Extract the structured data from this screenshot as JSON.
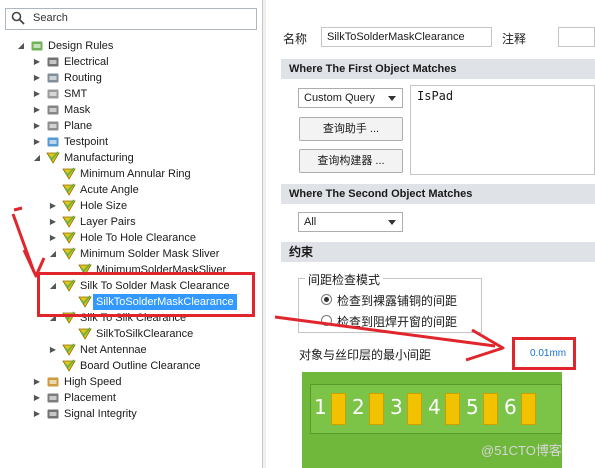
{
  "search": {
    "placeholder": "Search"
  },
  "tree": [
    {
      "label": "Design Rules",
      "arrow": "◢",
      "icon": "design-rules-icon"
    },
    {
      "label": "Electrical",
      "arrow": "▶",
      "icon": "electrical-icon"
    },
    {
      "label": "Routing",
      "arrow": "▶",
      "icon": "routing-icon"
    },
    {
      "label": "SMT",
      "arrow": "▶",
      "icon": "smt-icon"
    },
    {
      "label": "Mask",
      "arrow": "▶",
      "icon": "mask-icon"
    },
    {
      "label": "Plane",
      "arrow": "▶",
      "icon": "plane-icon"
    },
    {
      "label": "Testpoint",
      "arrow": "▶",
      "icon": "testpoint-icon"
    },
    {
      "label": "Manufacturing",
      "arrow": "◢",
      "icon": "rule-icon"
    },
    {
      "label": "Minimum Annular Ring",
      "arrow": "",
      "icon": "rule-icon"
    },
    {
      "label": "Acute Angle",
      "arrow": "",
      "icon": "rule-icon"
    },
    {
      "label": "Hole Size",
      "arrow": "▶",
      "icon": "rule-icon"
    },
    {
      "label": "Layer Pairs",
      "arrow": "▶",
      "icon": "rule-icon"
    },
    {
      "label": "Hole To Hole Clearance",
      "arrow": "▶",
      "icon": "rule-icon"
    },
    {
      "label": "Minimum Solder Mask Sliver",
      "arrow": "◢",
      "icon": "rule-icon"
    },
    {
      "label": "MinimumSolderMaskSliver",
      "arrow": "",
      "icon": "rule-icon"
    },
    {
      "label": "Silk To Solder Mask Clearance",
      "arrow": "◢",
      "icon": "rule-icon"
    },
    {
      "label": "SilkToSolderMaskClearance",
      "arrow": "",
      "icon": "rule-icon"
    },
    {
      "label": "Silk To Silk Clearance",
      "arrow": "◢",
      "icon": "rule-icon"
    },
    {
      "label": "SilkToSilkClearance",
      "arrow": "",
      "icon": "rule-icon"
    },
    {
      "label": "Net Antennae",
      "arrow": "▶",
      "icon": "rule-icon"
    },
    {
      "label": "Board Outline Clearance",
      "arrow": "",
      "icon": "rule-icon"
    },
    {
      "label": "High Speed",
      "arrow": "▶",
      "icon": "high-speed-icon"
    },
    {
      "label": "Placement",
      "arrow": "▶",
      "icon": "placement-icon"
    },
    {
      "label": "Signal Integrity",
      "arrow": "▶",
      "icon": "signal-integrity-icon"
    }
  ],
  "rule": {
    "name_label": "名称",
    "name_value": "SilkToSolderMaskClearance",
    "comment_label": "注释",
    "comment_value": ""
  },
  "first_match": {
    "header": "Where The First Object Matches",
    "query_type": "Custom Query",
    "query_text": "IsPad",
    "helper_button": "查询助手 ...",
    "builder_button": "查询构建器 ..."
  },
  "second_match": {
    "header": "Where The Second Object Matches",
    "query_type": "All"
  },
  "constraints": {
    "header": "约束",
    "mode_group_label": "间距检查模式",
    "option_exposed_copper": "检查到裸露铺铜的间距",
    "option_solder_mask_opening": "检查到阻焊开窗的间距",
    "selected_option": "option_exposed_copper",
    "min_clearance_label": "对象与丝印层的最小间距",
    "min_clearance_value": "0.01mm"
  },
  "diagram": {
    "pad_numbers": [
      "1",
      "2",
      "3",
      "4",
      "5",
      "6"
    ],
    "board_color": "#6fb83b",
    "pad_color": "#f2c200"
  },
  "watermark": "@51CTO博客",
  "colors": {
    "highlight": "#e0262c",
    "selection": "#3399ff",
    "value_blue": "#1a73c9"
  }
}
